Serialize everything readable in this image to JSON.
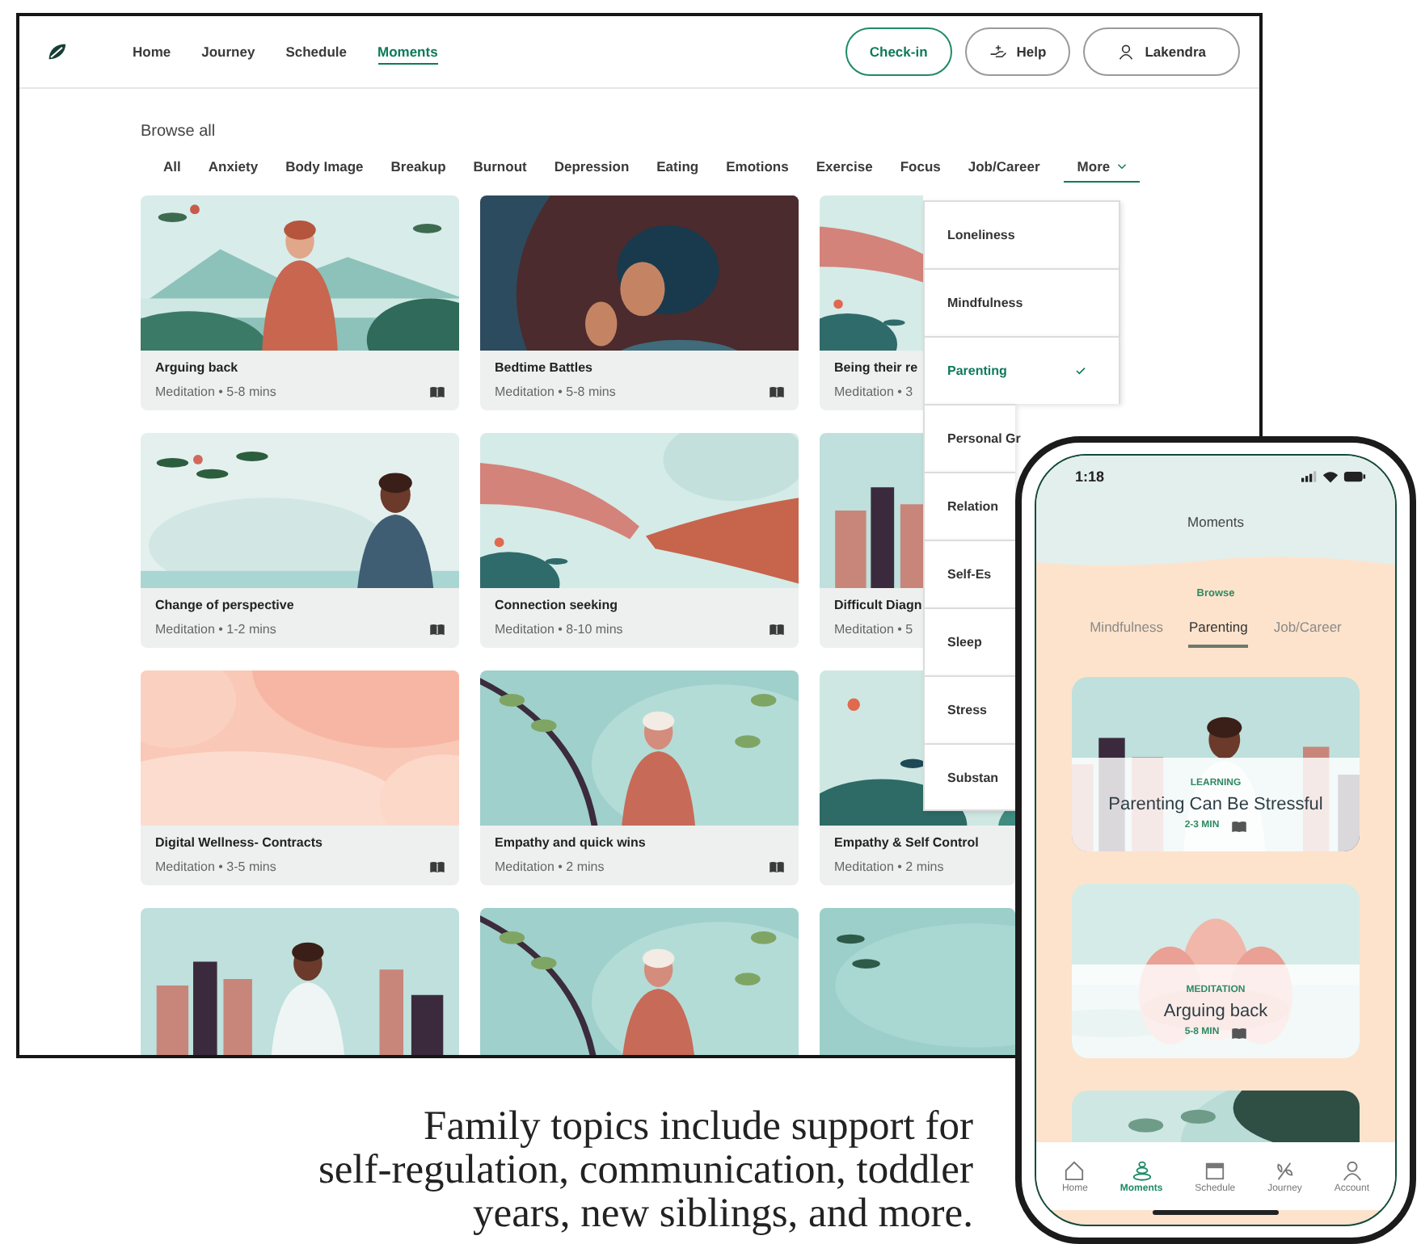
{
  "web": {
    "nav": [
      {
        "label": "Home",
        "selected": false
      },
      {
        "label": "Journey",
        "selected": false
      },
      {
        "label": "Schedule",
        "selected": false
      },
      {
        "label": "Moments",
        "selected": true
      }
    ],
    "header_buttons": [
      {
        "label": "Check-in",
        "kind": "accent"
      },
      {
        "label": "Help",
        "kind": "help"
      },
      {
        "label": "Lakendra",
        "kind": "account"
      }
    ],
    "heading": "Browse all",
    "filters": [
      {
        "label": "All",
        "kind": "tab",
        "selected": false
      },
      {
        "label": "Anxiety",
        "kind": "tab",
        "selected": false
      },
      {
        "label": "Body Image",
        "kind": "tab",
        "selected": false
      },
      {
        "label": "Breakup",
        "kind": "tab",
        "selected": false
      },
      {
        "label": "Burnout",
        "kind": "tab",
        "selected": false
      },
      {
        "label": "Depression",
        "kind": "tab",
        "selected": false
      },
      {
        "label": "Eating",
        "kind": "tab",
        "selected": false
      },
      {
        "label": "Emotions",
        "kind": "tab",
        "selected": false
      },
      {
        "label": "Exercise",
        "kind": "tab",
        "selected": false
      },
      {
        "label": "Focus",
        "kind": "tab",
        "selected": false
      },
      {
        "label": "Job/Career",
        "kind": "tab",
        "selected": false
      },
      {
        "label": "More",
        "kind": "dropdown",
        "selected": true
      }
    ],
    "cards": [
      {
        "kind": "picture",
        "title": "Arguing back",
        "meta": "Meditation • 5-8 mins",
        "book": true
      },
      {
        "kind": "picture",
        "title": "Bedtime Battles",
        "meta": "Meditation • 5-8 mins",
        "book": true
      },
      {
        "kind": "picture",
        "title": "Being their re",
        "meta": "Meditation • 3",
        "book": false
      },
      {
        "kind": "picture",
        "title": "Change of perspective",
        "meta": "Meditation • 1-2 mins",
        "book": true
      },
      {
        "kind": "picture",
        "title": "Connection seeking",
        "meta": "Meditation • 8-10 mins",
        "book": true
      },
      {
        "kind": "picture",
        "title": "Difficult Diagn",
        "meta": "Meditation • 5",
        "book": false
      },
      {
        "kind": "picture",
        "title": "Digital Wellness- Contracts",
        "meta": "Meditation • 3-5 mins",
        "book": true
      },
      {
        "kind": "picture",
        "title": "Empathy and quick wins",
        "meta": "Meditation • 2 mins",
        "book": true
      },
      {
        "kind": "picture",
        "title": "Empathy & Self Control",
        "meta": "Meditation • 2 mins",
        "book": false
      },
      {
        "kind": "picture"
      },
      {
        "kind": "picture"
      },
      {
        "kind": "picture"
      }
    ],
    "dropdown": [
      {
        "label": "Loneliness",
        "selected": false
      },
      {
        "label": "Mindfulness",
        "selected": false
      },
      {
        "label": "Parenting",
        "selected": true
      },
      {
        "label": "Personal Gr",
        "selected": false
      },
      {
        "label": "Relation",
        "selected": false
      },
      {
        "label": "Self-Es",
        "selected": false
      },
      {
        "label": "Sleep",
        "selected": false
      },
      {
        "label": "Stress",
        "selected": false
      },
      {
        "label": "Substan",
        "selected": false
      }
    ]
  },
  "phone": {
    "time": "1:18",
    "title": "Moments",
    "browse": "Browse",
    "tabs": [
      {
        "label": "Mindfulness",
        "selected": false
      },
      {
        "label": "Parenting",
        "selected": true
      },
      {
        "label": "Job/Career",
        "selected": false
      }
    ],
    "cards": [
      {
        "kind": "picture",
        "category": "LEARNING",
        "title": "Parenting Can Be Stressful",
        "duration": "2-3 MIN"
      },
      {
        "kind": "picture",
        "category": "MEDITATION",
        "title": "Arguing back",
        "duration": "5-8 MIN"
      },
      {
        "kind": "picture"
      }
    ],
    "nav": [
      {
        "label": "Home",
        "selected": false
      },
      {
        "label": "Moments",
        "selected": true
      },
      {
        "label": "Schedule",
        "selected": false
      },
      {
        "label": "Journey",
        "selected": false
      },
      {
        "label": "Account",
        "selected": false
      }
    ]
  },
  "caption": [
    "Family topics include support for",
    "self-regulation, communication, toddler",
    "years, new siblings, and more."
  ]
}
